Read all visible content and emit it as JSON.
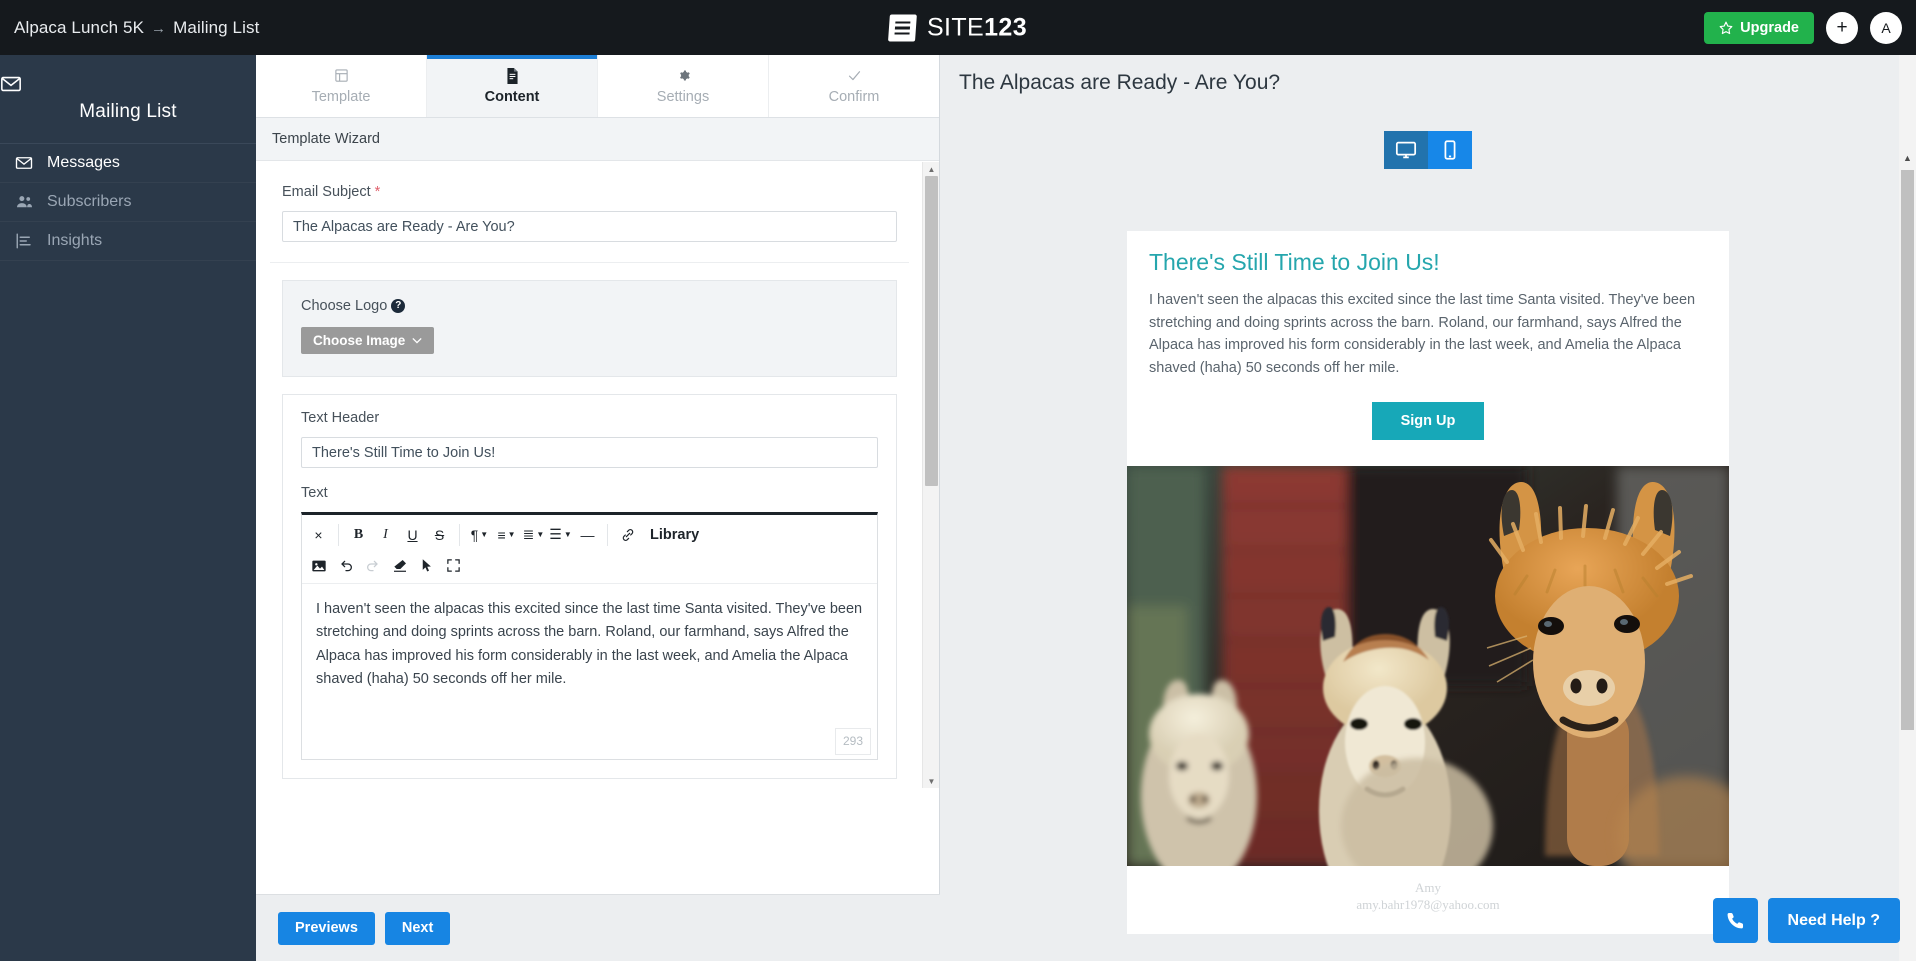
{
  "topbar": {
    "breadcrumb_site": "Alpaca Lunch 5K",
    "breadcrumb_sep": "→",
    "breadcrumb_section": "Mailing List",
    "brand_primary": "SITE",
    "brand_secondary": "123",
    "upgrade_label": "Upgrade",
    "add_label": "+",
    "avatar_label": "A",
    "upgrade_color": "#22b24c",
    "bg_color": "#15191d"
  },
  "sidebar": {
    "title": "Mailing List",
    "items": [
      {
        "label": "Messages",
        "icon": "envelope-icon",
        "active": true
      },
      {
        "label": "Subscribers",
        "icon": "users-icon",
        "active": false
      },
      {
        "label": "Insights",
        "icon": "chart-bar-icon",
        "active": false
      }
    ],
    "bg_color": "#2b3949"
  },
  "editor": {
    "tabs": [
      {
        "label": "Template",
        "icon": "grid-icon",
        "active": false
      },
      {
        "label": "Content",
        "icon": "file-icon",
        "active": true
      },
      {
        "label": "Settings",
        "icon": "gear-icon",
        "active": false
      },
      {
        "label": "Confirm",
        "icon": "check-icon",
        "active": false
      }
    ],
    "active_tab_color": "#1d7fd6",
    "wizard_label": "Template Wizard",
    "email_subject": {
      "label": "Email Subject",
      "required_mark": "*",
      "value": "The Alpacas are Ready - Are You?"
    },
    "choose_logo": {
      "label": "Choose Logo",
      "help_glyph": "?",
      "button_label": "Choose Image",
      "caret": "⌄"
    },
    "text_header": {
      "label": "Text Header",
      "value": "There's Still Time to Join Us!"
    },
    "text_field": {
      "label": "Text",
      "body": "I haven't seen the alpacas this excited since the last time Santa visited. They've been stretching and doing sprints across the barn. Roland, our farmhand, says Alfred the Alpaca has improved his form considerably in the last week, and Amelia the Alpaca shaved (haha) 50 seconds off her mile.",
      "char_count": "293"
    },
    "toolbar_row1": [
      {
        "name": "clear-formatting-icon",
        "glyph": "×",
        "disabled": false,
        "caret": false
      },
      {
        "name": "bold-icon",
        "glyph": "B",
        "disabled": false,
        "caret": false
      },
      {
        "name": "italic-icon",
        "glyph": "I",
        "disabled": false,
        "caret": false
      },
      {
        "name": "underline-icon",
        "glyph": "U",
        "disabled": false,
        "caret": false
      },
      {
        "name": "strikethrough-icon",
        "glyph": "S",
        "disabled": false,
        "caret": false
      },
      {
        "name": "paragraph-format-icon",
        "glyph": "¶",
        "disabled": false,
        "caret": true
      },
      {
        "name": "align-icon",
        "glyph": "≡",
        "disabled": false,
        "caret": true
      },
      {
        "name": "ordered-list-icon",
        "glyph": "≣",
        "disabled": false,
        "caret": true
      },
      {
        "name": "unordered-list-icon",
        "glyph": "☰",
        "disabled": false,
        "caret": true
      },
      {
        "name": "horizontal-rule-icon",
        "glyph": "—",
        "disabled": false,
        "caret": false
      }
    ],
    "toolbar_link": {
      "name": "link-icon",
      "glyph": "🔗"
    },
    "toolbar_library_label": "Library",
    "toolbar_row2": [
      {
        "name": "insert-image-icon",
        "glyph": "⛰",
        "disabled": false
      },
      {
        "name": "undo-icon",
        "glyph": "↶",
        "disabled": false
      },
      {
        "name": "redo-icon",
        "glyph": "↷",
        "disabled": true
      },
      {
        "name": "eraser-icon",
        "glyph": "◆",
        "disabled": false
      },
      {
        "name": "select-cursor-icon",
        "glyph": "➤",
        "disabled": false
      },
      {
        "name": "fullscreen-icon",
        "glyph": "⛶",
        "disabled": false
      }
    ],
    "footer": {
      "previews_label": "Previews",
      "next_label": "Next",
      "button_color": "#1785e3"
    }
  },
  "preview": {
    "title": "The Alpacas are Ready - Are You?",
    "devices": [
      {
        "name": "desktop-view",
        "icon": "desktop-icon",
        "active": true
      },
      {
        "name": "mobile-view",
        "icon": "mobile-icon",
        "active": false
      }
    ],
    "email": {
      "heading": "There's Still Time to Join Us!",
      "heading_color": "#25a6ad",
      "body": "I haven't seen the alpacas this excited since the last time Santa visited. They've been stretching and doing sprints across the barn. Roland, our farmhand, says Alfred the Alpaca has improved his form considerably in the last week, and Amelia the Alpaca shaved (haha) 50 seconds off her mile.",
      "cta_label": "Sign Up",
      "cta_color": "#17a8b8",
      "photo_alt": "Three alpacas looking at the camera in front of a red barn",
      "footer_name": "Amy",
      "footer_email": "amy.bahr1978@yahoo.com"
    }
  },
  "help": {
    "phone_icon": "phone-icon",
    "need_help_label": "Need Help ?",
    "color": "#1785e3"
  }
}
